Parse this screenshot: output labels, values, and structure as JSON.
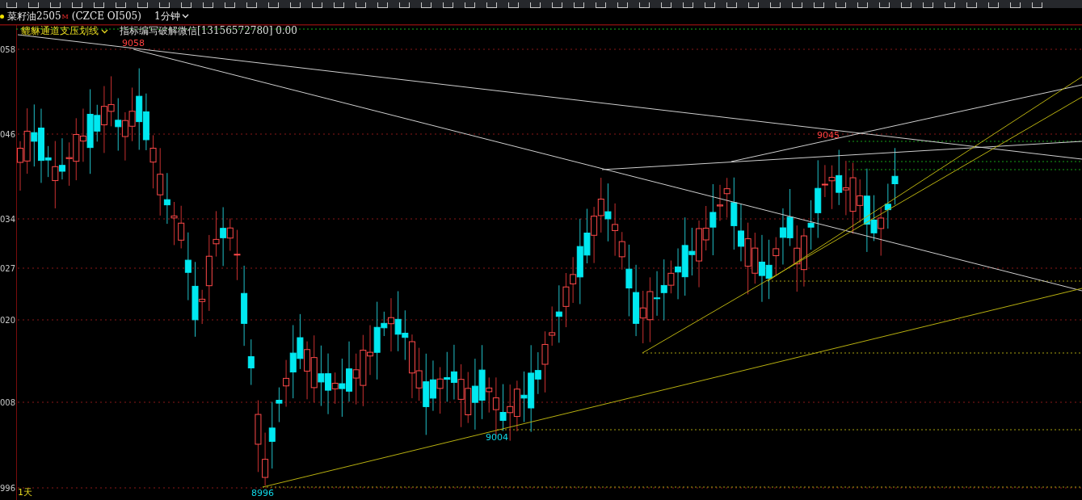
{
  "instrument": {
    "name": "菜籽油2505",
    "flag": "M",
    "code": "(CZCE OI505)",
    "period": "1分钟"
  },
  "indicator": {
    "name": "貔貅通道支压划线",
    "note": "指标编写破解微信[13156572780] 0.00"
  },
  "axis_labels": [
    "058",
    "046",
    "034",
    "027",
    "020",
    "008",
    "996"
  ],
  "price_marks": [
    {
      "text": "9058",
      "kind": "high"
    },
    {
      "text": "9045",
      "kind": "high"
    },
    {
      "text": "9004",
      "kind": "low"
    },
    {
      "text": "8996",
      "kind": "low"
    }
  ],
  "timeframe": "1天"
}
